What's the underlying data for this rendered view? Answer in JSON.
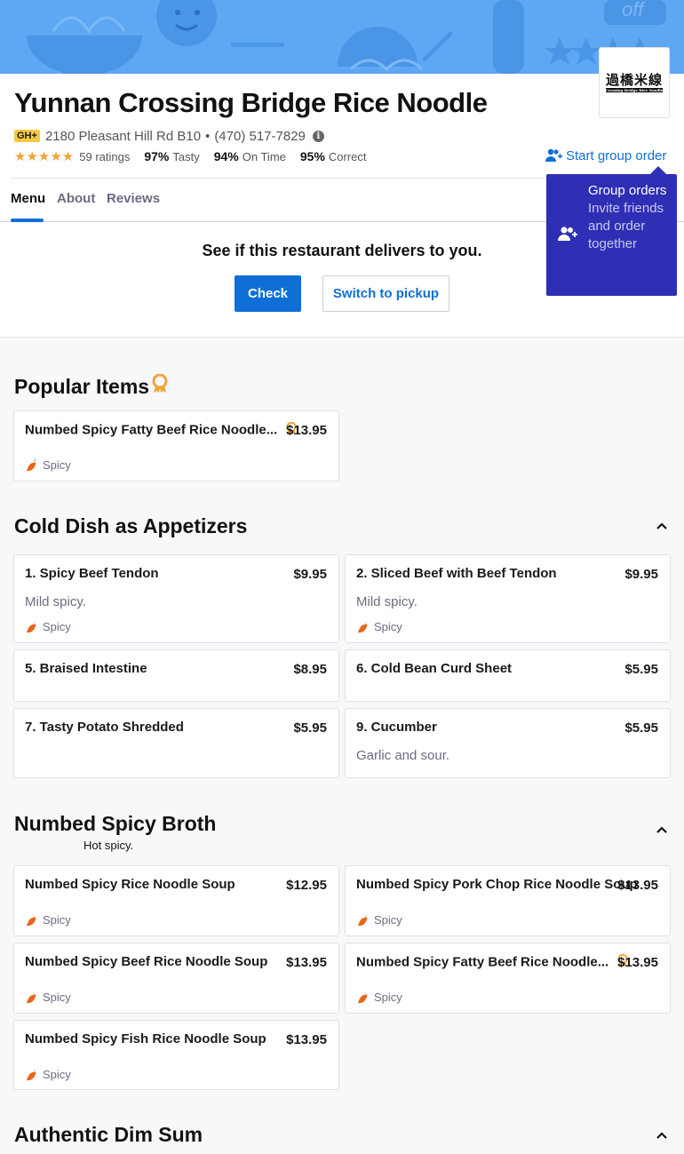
{
  "restaurant": {
    "name": "Yunnan Crossing Bridge Rice Noodle",
    "badge": "GH+",
    "address": "2180 Pleasant Hill Rd B10",
    "separator": "•",
    "phone": "(470) 517-7829",
    "stars": "★★★★★",
    "ratings": "59 ratings",
    "stats": [
      {
        "value": "97%",
        "label": "Tasty"
      },
      {
        "value": "94%",
        "label": "On Time"
      },
      {
        "value": "95%",
        "label": "Correct"
      }
    ],
    "logo_text": "過橋米線",
    "logo_sub": "Crossing Bridge Rice Noodle"
  },
  "group_order": {
    "link": "Start group order",
    "tooltip_title": "Group orders",
    "tooltip_body": "Invite friends and order together"
  },
  "tabs": [
    "Menu",
    "About",
    "Reviews"
  ],
  "delivery": {
    "title": "See if this restaurant delivers to you.",
    "check": "Check",
    "pickup": "Switch to pickup"
  },
  "spicy_label": "Spicy",
  "sections": {
    "popular": {
      "title": "Popular Items",
      "items": [
        {
          "name": "Numbed Spicy Fatty Beef Rice Noodle...",
          "price": "$13.95"
        }
      ]
    },
    "cold": {
      "title": "Cold Dish as Appetizers",
      "items": [
        {
          "name": "1. Spicy Beef Tendon",
          "price": "$9.95",
          "desc": "Mild spicy."
        },
        {
          "name": "2. Sliced Beef with Beef Tendon",
          "price": "$9.95",
          "desc": "Mild spicy."
        },
        {
          "name": "5. Braised Intestine",
          "price": "$8.95"
        },
        {
          "name": "6. Cold Bean Curd Sheet",
          "price": "$5.95"
        },
        {
          "name": "7. Tasty Potato Shredded",
          "price": "$5.95"
        },
        {
          "name": "9. Cucumber",
          "price": "$5.95",
          "desc": "Garlic and sour."
        }
      ]
    },
    "broth": {
      "title": "Numbed Spicy Broth",
      "subtitle": "Hot spicy.",
      "items": [
        {
          "name": "Numbed Spicy Rice Noodle Soup",
          "price": "$12.95"
        },
        {
          "name": "Numbed Spicy Pork Chop Rice Noodle Soup",
          "price": "$13.95"
        },
        {
          "name": "Numbed Spicy Beef Rice Noodle Soup",
          "price": "$13.95"
        },
        {
          "name": "Numbed Spicy Fatty Beef Rice Noodle...",
          "price": "$13.95"
        },
        {
          "name": "Numbed Spicy Fish Rice Noodle Soup",
          "price": "$13.95"
        }
      ]
    },
    "dimsum": {
      "title": "Authentic Dim Sum"
    }
  },
  "colors": {
    "banner": "#5ea8f3",
    "accent": "#0f6fd6",
    "tooltip": "#2e2fb4",
    "star": "#f2a33a",
    "award": "#f2a33a",
    "pepper": "#e8651a"
  }
}
